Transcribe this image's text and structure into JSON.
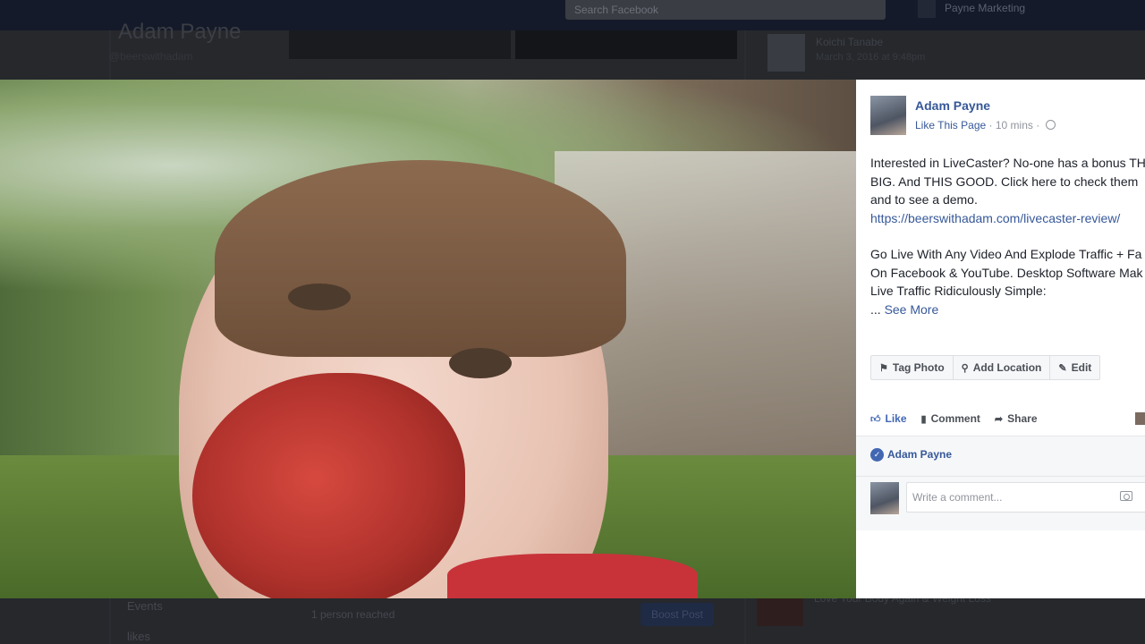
{
  "background": {
    "search_placeholder": "Search Facebook",
    "nav_user": "Payne Marketing",
    "page_name": "Adam Payne",
    "page_handle": "@beerswithadam",
    "right_feed_name": "Koichi Tanabe",
    "right_feed_sub": "March 3, 2016 at 9:48pm",
    "left_nav_events": "Events",
    "left_likes": "likes",
    "reach_text": "1 person reached",
    "boost_label": "Boost Post",
    "bottom_feed_text": "Love Your Body Again & Weight Loss"
  },
  "post": {
    "author": "Adam Payne",
    "like_page": "Like This Page",
    "time": "10 mins",
    "separator": "·",
    "text_lines": [
      "Interested in LiveCaster? No-one has a bonus TH",
      "BIG. And THIS GOOD. Click here to check them",
      "and to see a demo."
    ],
    "url": "https://beerswithadam.com/livecaster-review/",
    "text_lines_2": [
      "Go Live With Any Video And Explode Traffic + Fa",
      "On Facebook & YouTube. Desktop Software Mak",
      "Live Traffic Ridiculously Simple:"
    ],
    "see_more_prefix": "... ",
    "see_more": "See More"
  },
  "edit_bar": {
    "tag_photo": "Tag Photo",
    "add_location": "Add Location",
    "edit": "Edit"
  },
  "actions": {
    "like": "Like",
    "comment": "Comment",
    "share": "Share"
  },
  "likers": {
    "name": "Adam Payne"
  },
  "comment": {
    "placeholder": "Write a comment..."
  },
  "icons": {
    "tag": "tag-icon",
    "location": "location-pin-icon",
    "edit": "pencil-icon",
    "like": "thumbs-up-icon",
    "comment": "comment-bubble-icon",
    "share": "share-arrow-icon",
    "camera": "camera-icon",
    "globe": "globe-icon"
  },
  "colors": {
    "link": "#365899",
    "like_blue": "#4267b2",
    "topbar": "#141a29"
  }
}
